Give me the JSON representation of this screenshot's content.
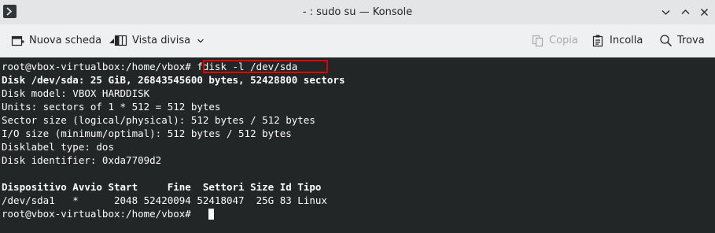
{
  "window": {
    "title": "- : sudo su — Konsole"
  },
  "toolbar": {
    "new_tab": "Nuova scheda",
    "split_view": "Vista divisa",
    "copy": "Copia",
    "paste": "Incolla",
    "find": "Trova"
  },
  "terminal": {
    "lines": [
      "root@vbox-virtualbox:/home/vbox# fdisk -l /dev/sda",
      "Disk /dev/sda: 25 GiB, 26843545600 bytes, 52428800 sectors",
      "Disk model: VBOX HARDDISK",
      "Units: sectors of 1 * 512 = 512 bytes",
      "Sector size (logical/physical): 512 bytes / 512 bytes",
      "I/O size (minimum/optimal): 512 bytes / 512 bytes",
      "Disklabel type: dos",
      "Disk identifier: 0xda7709d2",
      "",
      "Dispositivo Avvio Start     Fine  Settori Size Id Tipo",
      "/dev/sda1   *      2048 52420094 52418047  25G 83 Linux",
      "root@vbox-virtualbox:/home/vbox# "
    ]
  },
  "colors": {
    "terminal_bg": "#232627",
    "terminal_fg": "#fcfcfc",
    "highlight": "#e00000"
  },
  "icons": [
    "konsole-icon",
    "new-tab-icon",
    "split-view-icon",
    "copy-icon",
    "paste-icon",
    "search-icon",
    "chevron-down-icon",
    "minimize-icon",
    "maximize-icon",
    "close-icon"
  ]
}
